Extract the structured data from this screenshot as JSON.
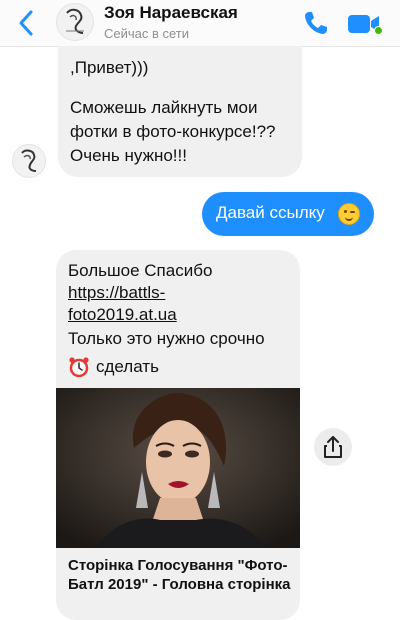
{
  "header": {
    "contact_name": "Зоя Нараевская",
    "status": "Сейчас в сети"
  },
  "messages": {
    "incoming_1": {
      "lines": [
        ",Привет)))",
        "Сможешь лайкнуть мои",
        "фотки в фото-конкурсе!??",
        "Очень нужно!!!"
      ]
    },
    "outgoing_1": {
      "text": "Давай ссылку",
      "emoji": "wink-emoji"
    },
    "incoming_2": {
      "line1": "Большое Спасибо",
      "link_line1": "https://battls-",
      "link_line2": "foto2019.at.ua",
      "line4": "Только это нужно срочно",
      "line5": "сделать",
      "emoji": "alarm-clock-emoji",
      "preview_title": "Сторінка Голосування \"Фото-Батл 2019\" - Головна сторінка"
    }
  },
  "colors": {
    "accent": "#1f8fff",
    "incoming_bubble": "#f1f0f0",
    "online": "#44b700"
  },
  "icons": {
    "back": "chevron-left-icon",
    "call": "phone-icon",
    "video": "video-camera-icon",
    "share": "share-icon"
  }
}
